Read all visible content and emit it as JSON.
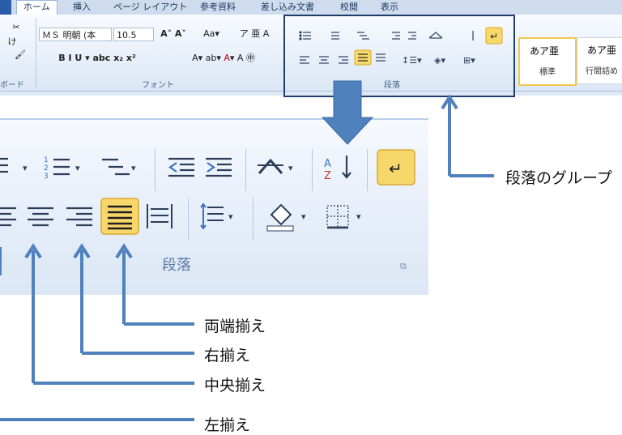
{
  "ribbon": {
    "tabs": [
      "ホーム",
      "挿入",
      "ページ レイアウト",
      "参考資料",
      "差し込み文書",
      "校閲",
      "表示"
    ],
    "font_name": "ＭＳ 明朝 (本",
    "font_size": "10.5",
    "groups": {
      "clipboard_fragment": "ボード",
      "font": "フォント",
      "paragraph": "段落"
    },
    "styles": [
      {
        "preview": "あア亜",
        "name": "標準"
      },
      {
        "preview": "あア亜",
        "name": "行間詰め"
      }
    ]
  },
  "magnified_group_label": "段落",
  "callouts": {
    "group": "段落のグループ",
    "justify": "両端揃え",
    "right": "右揃え",
    "center": "中央揃え",
    "left": "左揃え"
  },
  "colors": {
    "arrow": "#4f81bd",
    "highlight_border": "#1f3e6e",
    "active_button": "#f7d96b"
  }
}
